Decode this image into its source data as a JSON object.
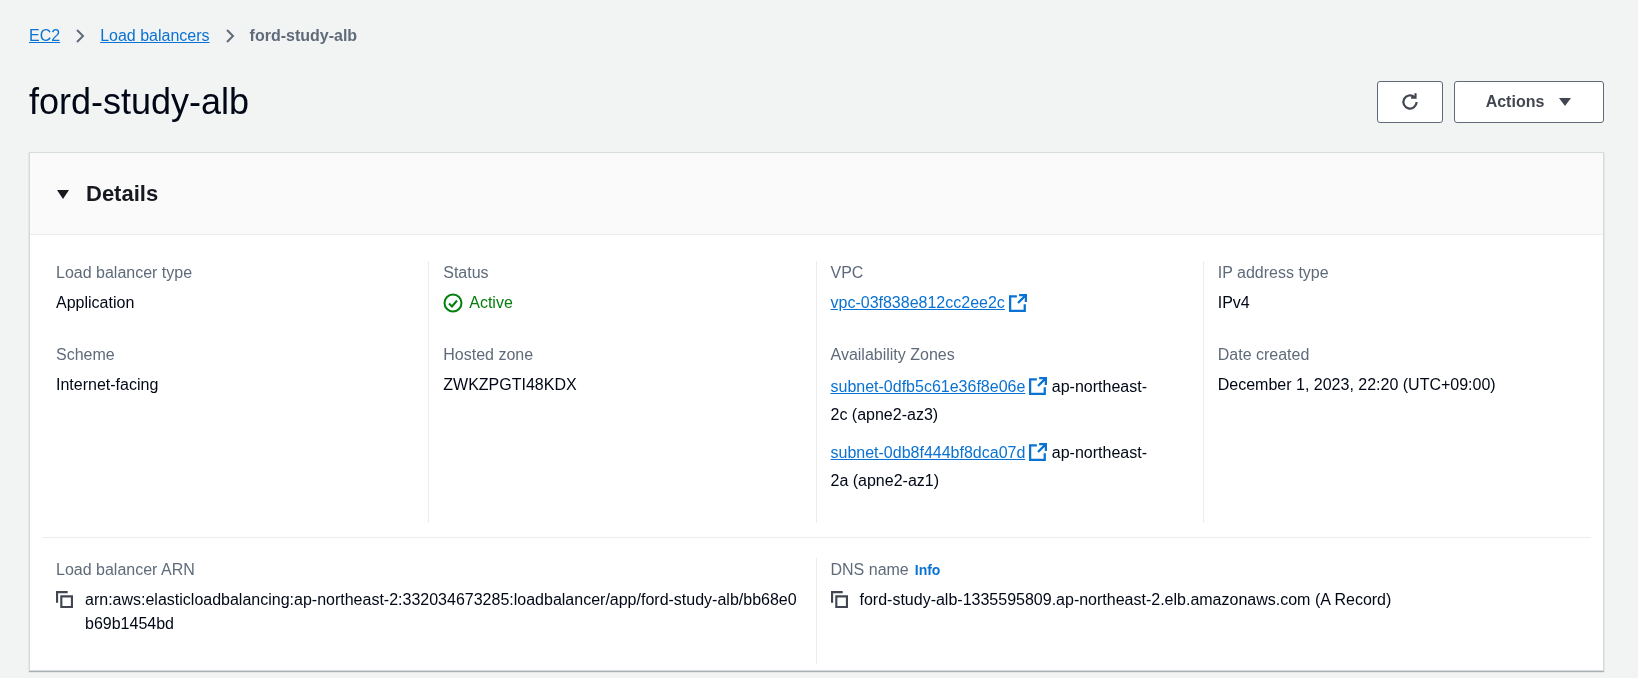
{
  "breadcrumbs": [
    {
      "label": "EC2",
      "kind": "link"
    },
    {
      "label": "Load balancers",
      "kind": "link"
    },
    {
      "label": "ford-study-alb",
      "kind": "current"
    }
  ],
  "title": "ford-study-alb",
  "actions": {
    "label": "Actions"
  },
  "details": {
    "title": "Details",
    "expanded": true,
    "columns": [
      [
        {
          "label": "Load balancer type",
          "kind": "text",
          "value": "Application"
        },
        {
          "label": "Scheme",
          "kind": "text",
          "value": "Internet-facing"
        }
      ],
      [
        {
          "label": "Status",
          "kind": "status",
          "value": "Active"
        },
        {
          "label": "Hosted zone",
          "kind": "text",
          "value": "ZWKZPGTI48KDX"
        }
      ],
      [
        {
          "label": "VPC",
          "kind": "link",
          "value": "vpc-03f838e812cc2ee2c"
        },
        {
          "label": "Availability Zones",
          "kind": "subnets",
          "items": [
            {
              "link": "subnet-0dfb5c61e36f8e06e",
              "zone": "ap-northeast-2c (apne2-az3)"
            },
            {
              "link": "subnet-0db8f444bf8dca07d",
              "zone": "ap-northeast-2a (apne2-az1)"
            }
          ]
        }
      ],
      [
        {
          "label": "IP address type",
          "kind": "text",
          "value": "IPv4"
        },
        {
          "label": "Date created",
          "kind": "text",
          "value": "December 1, 2023, 22:20 (UTC+09:00)"
        }
      ]
    ],
    "bottom": [
      {
        "label": "Load balancer ARN",
        "kind": "copy",
        "value": "arn:aws:elasticloadbalancing:ap-northeast-2:332034673285:loadbalancer/app/ford-study-alb/bb68e0b69b1454bd"
      },
      {
        "label": "DNS name",
        "info": "Info",
        "kind": "copy",
        "value": "ford-study-alb-1335595809.ap-northeast-2.elb.amazonaws.com (A Record)"
      }
    ]
  }
}
